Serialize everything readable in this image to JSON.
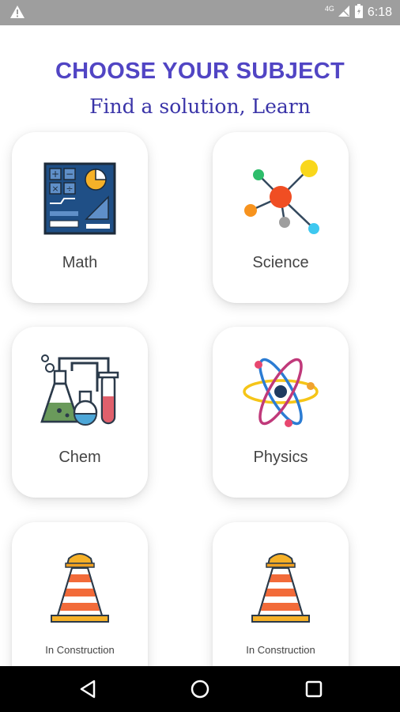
{
  "status_bar": {
    "warning_icon": "warning-icon",
    "network_label": "4G",
    "time": "6:18"
  },
  "header": {
    "title": "CHOOSE YOUR SUBJECT",
    "subtitle": "Find a solution, Learn"
  },
  "colors": {
    "title": "#5145c4",
    "subtitle": "#3a34a8",
    "status_bar": "#9e9e9e",
    "nav_bar": "#000000"
  },
  "subjects": [
    {
      "label": "Math",
      "icon": "math-calculator-icon"
    },
    {
      "label": "Science",
      "icon": "molecule-icon"
    },
    {
      "label": "Chem",
      "icon": "chemistry-flasks-icon"
    },
    {
      "label": "Physics",
      "icon": "atom-icon"
    },
    {
      "label": "In Construction",
      "icon": "traffic-cone-icon"
    },
    {
      "label": "In Construction",
      "icon": "traffic-cone-icon"
    }
  ],
  "nav": {
    "back": "back-icon",
    "home": "home-icon",
    "recents": "recents-icon"
  }
}
